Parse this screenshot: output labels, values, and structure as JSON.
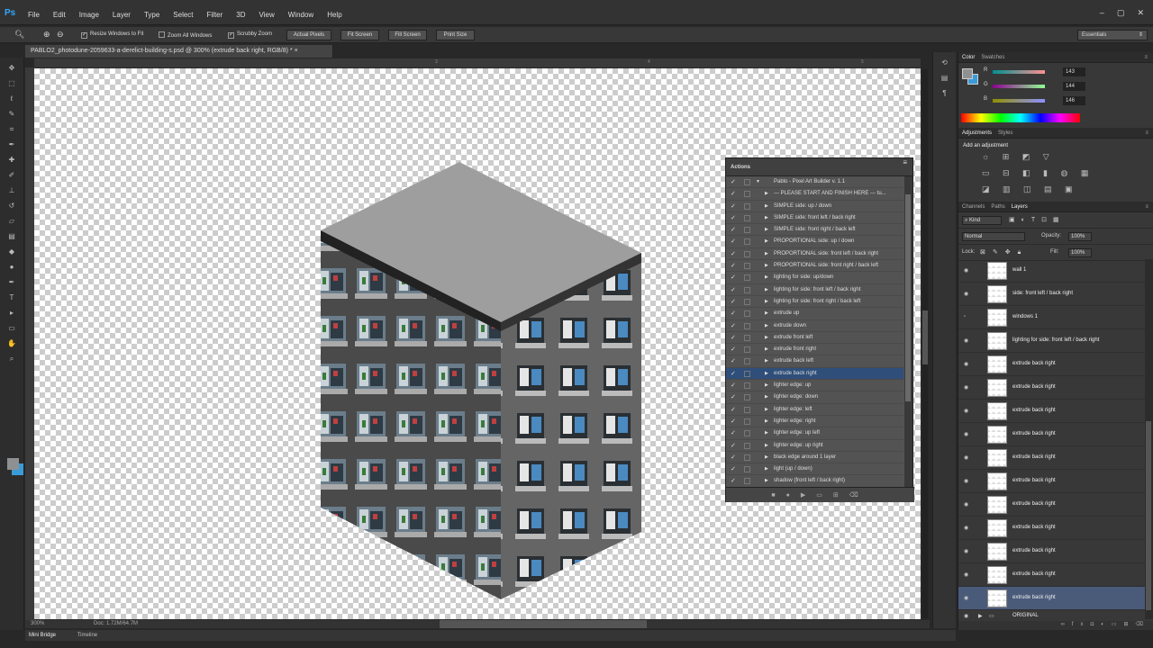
{
  "app": {
    "logo": "Ps",
    "menus": [
      "File",
      "Edit",
      "Image",
      "Layer",
      "Type",
      "Select",
      "Filter",
      "3D",
      "View",
      "Window",
      "Help"
    ],
    "window_controls": [
      "–",
      "▢",
      "✕"
    ]
  },
  "options": {
    "resize_windows": "Resize Windows to Fit",
    "zoom_all": "Zoom All Windows",
    "scrubby": "Scrubby Zoom",
    "actual_pixels": "Actual Pixels",
    "fit_screen": "Fit Screen",
    "fill_screen": "Fill Screen",
    "print_size": "Print Size",
    "workspace": "Essentials"
  },
  "document": {
    "tab_title": "PABLO2_photodune-2059633-a-derelict-building-s.psd @ 300% (extrude back right, RGB/8) *",
    "tab_close": "×",
    "ruler_marks": [
      "3",
      "4",
      "5"
    ],
    "zoom": "300%",
    "doc_info": "Doc: 1.72M/64.7M"
  },
  "bottom_tabs": [
    "Mini Bridge",
    "Timeline"
  ],
  "actions": {
    "title": "Actions",
    "set_name": "Pablo - Pixel Art Builder v. 1.1",
    "items": [
      "--- PLEASE START AND FINISH HERE --- tu...",
      "SIMPLE side: up / down",
      "SIMPLE side: front left / back right",
      "SIMPLE side: front right / back left",
      "PROPORTIONAL side: up / down",
      "PROPORTIONAL side: front left / back right",
      "PROPORTIONAL side: front right / back left",
      "lighting for side: up/down",
      "lighting for side: front left / back right",
      "lighting for side: front right / back left",
      "extrude up",
      "extrude down",
      "extrude front left",
      "extrude front right",
      "extrude back left",
      "extrude back right",
      "lighter edge: up",
      "lighter edge: down",
      "lighter edge: left",
      "lighter edge: right",
      "lighter edge: up left",
      "lighter edge: up right",
      "black edge around 1 layer",
      "light (up / down)",
      "shadow (front left / back right)"
    ],
    "selected_index": 15
  },
  "color_panel": {
    "tabs": [
      "Color",
      "Swatches"
    ],
    "channels": [
      {
        "label": "R",
        "value": "143"
      },
      {
        "label": "G",
        "value": "144"
      },
      {
        "label": "B",
        "value": "146"
      }
    ],
    "fg": "#8f9092",
    "bg": "#3a9bd9"
  },
  "adjustments": {
    "tabs": [
      "Adjustments",
      "Styles"
    ],
    "title": "Add an adjustment",
    "icon_rows": [
      "☼ ⊞ ◩ ▽",
      "▭ ⊟ ◧ ▮ ◍ ▦",
      "◪ ▥ ◫ ▤ ▣"
    ]
  },
  "layers_panel": {
    "tabs": [
      "Channels",
      "Paths",
      "Layers"
    ],
    "kind": "Kind",
    "blend": "Normal",
    "opacity_label": "Opacity:",
    "opacity": "100%",
    "lock_label": "Lock:",
    "fill_label": "Fill:",
    "fill": "100%",
    "layers": [
      {
        "name": "wall 1",
        "visible": true
      },
      {
        "name": "side: front left / back right",
        "visible": true
      },
      {
        "name": "windows 1",
        "visible": false
      },
      {
        "name": "lighting for side: front left / back right",
        "visible": true
      },
      {
        "name": "extrude back right",
        "visible": true
      },
      {
        "name": "extrude back right",
        "visible": true
      },
      {
        "name": "extrude back right",
        "visible": true
      },
      {
        "name": "extrude back right",
        "visible": true
      },
      {
        "name": "extrude back right",
        "visible": true
      },
      {
        "name": "extrude back right",
        "visible": true
      },
      {
        "name": "extrude back right",
        "visible": true
      },
      {
        "name": "extrude back right",
        "visible": true
      },
      {
        "name": "extrude back right",
        "visible": true
      },
      {
        "name": "extrude back right",
        "visible": true
      },
      {
        "name": "extrude back right",
        "visible": true
      }
    ],
    "group": "ORIGINAL",
    "selected_index": 14
  }
}
